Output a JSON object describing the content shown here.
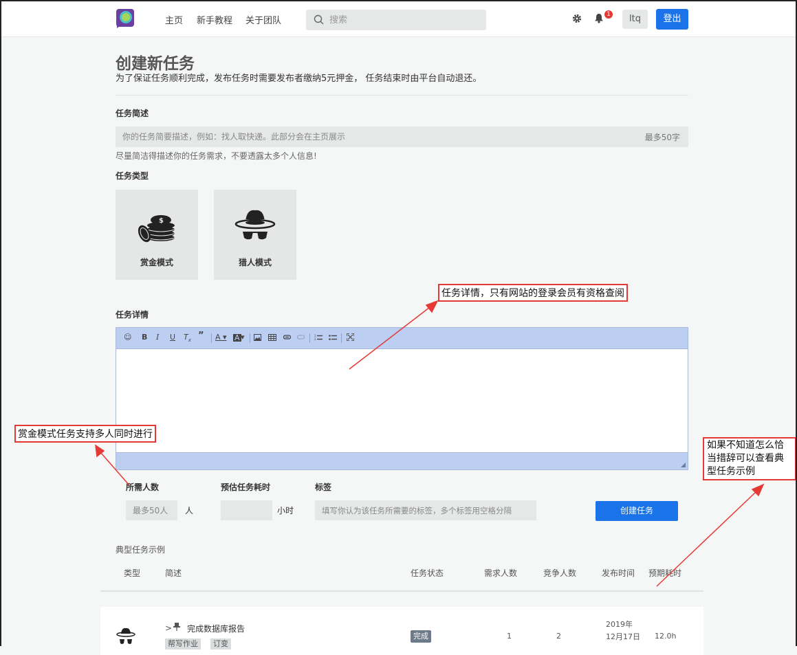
{
  "nav": {
    "links": [
      "主页",
      "新手教程",
      "关于团队"
    ],
    "search_placeholder": "搜索",
    "notification_count": "1",
    "user": "ltq",
    "logout_label": "登出"
  },
  "page": {
    "title": "创建新任务",
    "subtitle": "为了保证任务顺利完成，发布任务时需要发布者缴纳5元押金， 任务结束时由平台自动退还。"
  },
  "summary": {
    "label": "任务简述",
    "placeholder": "你的任务简要描述，例如：找人取快递。此部分会在主页展示",
    "max_label": "最多50字",
    "hint": "尽量简洁得描述你的任务需求，不要透露太多个人信息!"
  },
  "task_type": {
    "label": "任务类型",
    "options": [
      {
        "label": "赏金模式",
        "icon": "coins-icon"
      },
      {
        "label": "猎人模式",
        "icon": "hat-sunglasses-icon"
      }
    ]
  },
  "details": {
    "label": "任务详情",
    "toolbar": [
      "emoji",
      "B",
      "I",
      "U",
      "Tx",
      "quote",
      "A",
      "A-bg",
      "image",
      "table",
      "link",
      "unlink",
      "ordered-list",
      "unordered-list",
      "fullscreen"
    ]
  },
  "fields": {
    "people_label": "所需人数",
    "people_placeholder": "最多50人",
    "people_unit": "人",
    "time_label": "预估任务耗时",
    "time_unit": "小时",
    "tags_label": "标签",
    "tags_placeholder": "填写你认为该任务所需要的标签，多个标签用空格分隔",
    "create_label": "创建任务"
  },
  "examples": {
    "title": "典型任务示例",
    "columns": [
      "类型",
      "简述",
      "任务状态",
      "需求人数",
      "竞争人数",
      "发布时间",
      "预期耗时"
    ],
    "rows": [
      {
        "prefix": ">",
        "title": "完成数据库报告",
        "tags": [
          "帮写作业",
          "订变"
        ],
        "status": "完成",
        "required": "1",
        "competing": "2",
        "date_line1": "2019年",
        "date_line2": "12月17日",
        "duration": "12.0h"
      }
    ]
  },
  "annotations": {
    "details_note": "任务详情，只有网站的登录会员有资格查阅",
    "bounty_note": "赏金模式任务支持多人同时进行",
    "examples_note_1": "如果不知道怎么恰",
    "examples_note_2": "当措辞可以查看典",
    "examples_note_3": "型任务示例"
  },
  "colors": {
    "primary": "#1a73e8",
    "annotation": "#e53935",
    "editor_bar": "#bccff3"
  }
}
